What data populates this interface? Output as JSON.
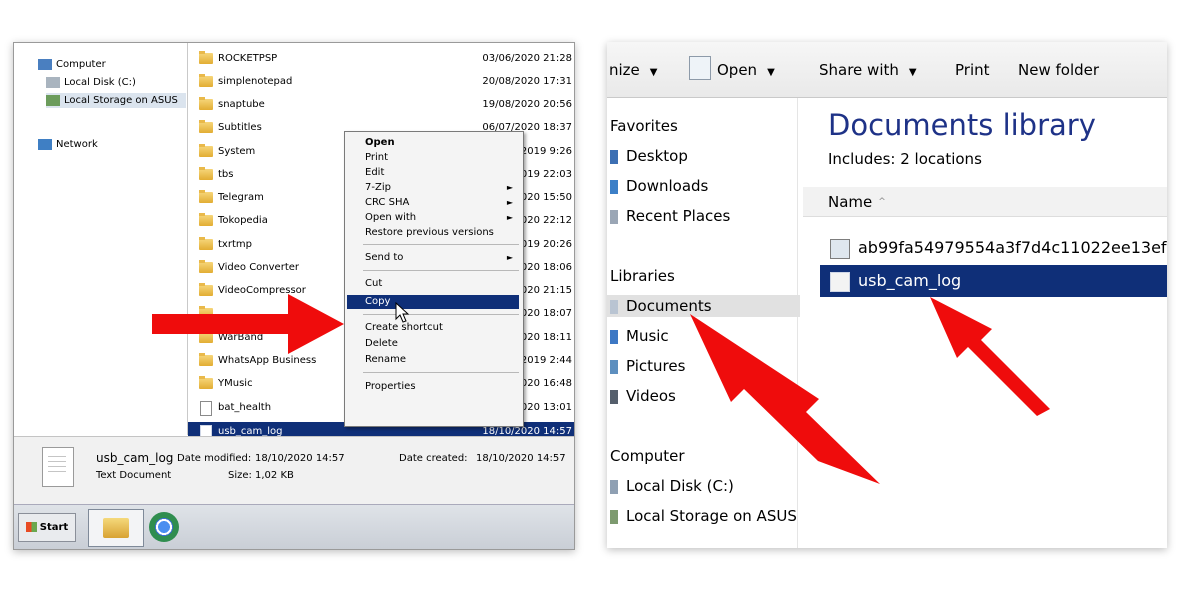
{
  "left_window": {
    "nav": {
      "computer": "Computer",
      "local_disk": "Local Disk (C:)",
      "local_storage": "Local Storage on ASUS",
      "network": "Network"
    },
    "files": [
      {
        "name": "ROCKETPSP",
        "date": "03/06/2020 21:28"
      },
      {
        "name": "simplenotepad",
        "date": "20/08/2020 17:31"
      },
      {
        "name": "snaptube",
        "date": "19/08/2020 20:56"
      },
      {
        "name": "Subtitles",
        "date": "06/07/2020 18:37"
      },
      {
        "name": "System",
        "date": "/2019 9:26"
      },
      {
        "name": "tbs",
        "date": "/2019 22:03"
      },
      {
        "name": "Telegram",
        "date": "/2020 15:50"
      },
      {
        "name": "Tokopedia",
        "date": "/2020 22:12"
      },
      {
        "name": "txrtmp",
        "date": "/2019 20:26"
      },
      {
        "name": "Video Converter",
        "date": "/2020 18:06"
      },
      {
        "name": "VideoCompressor",
        "date": "/2020 21:15"
      },
      {
        "name": "",
        "date": "/2020 18:07"
      },
      {
        "name": "WarBand",
        "date": "/2020 18:11"
      },
      {
        "name": "WhatsApp Business",
        "date": "/2019 2:44"
      },
      {
        "name": "YMusic",
        "date": "/2020 16:48"
      },
      {
        "name": "bat_health",
        "date": "/2020 13:01"
      },
      {
        "name": "usb_cam_log",
        "date": "18/10/2020 14:57"
      }
    ],
    "context_menu": {
      "open": "Open",
      "print": "Print",
      "edit": "Edit",
      "zip": "7-Zip",
      "crc": "CRC SHA",
      "open_with": "Open with",
      "restore": "Restore previous versions",
      "send_to": "Send to",
      "cut": "Cut",
      "copy": "Copy",
      "create_shortcut": "Create shortcut",
      "delete": "Delete",
      "rename": "Rename",
      "properties": "Properties",
      "submenu_arrow": "►"
    },
    "details": {
      "name": "usb_cam_log",
      "type": "Text Document",
      "modified_label": "Date modified:",
      "modified": "18/10/2020 14:57",
      "size_label": "Size:",
      "size": "1,02 KB",
      "created_label": "Date created:",
      "created": "18/10/2020 14:57"
    },
    "taskbar": {
      "start": "Start"
    }
  },
  "right_window": {
    "toolbar": {
      "organize": "nize",
      "open": "Open",
      "share": "Share with",
      "print": "Print",
      "new_folder": "New folder",
      "dropdown": "▼"
    },
    "nav": {
      "favorites": "Favorites",
      "desktop": "Desktop",
      "downloads": "Downloads",
      "recent": "Recent Places",
      "libraries": "Libraries",
      "documents": "Documents",
      "music": "Music",
      "pictures": "Pictures",
      "videos": "Videos",
      "computer": "Computer",
      "local_disk": "Local Disk (C:)",
      "local_storage": "Local Storage on ASUS"
    },
    "library_title": "Documents library",
    "includes": "Includes: 2 locations",
    "column_name": "Name",
    "sort_glyph": "^",
    "files": [
      {
        "name": "ab99fa54979554a3f7d4c11022ee13ef"
      },
      {
        "name": "usb_cam_log"
      }
    ]
  },
  "colors": {
    "selection": "#0f2f78",
    "arrow": "#ef0c0c",
    "library_title": "#1e3287"
  }
}
